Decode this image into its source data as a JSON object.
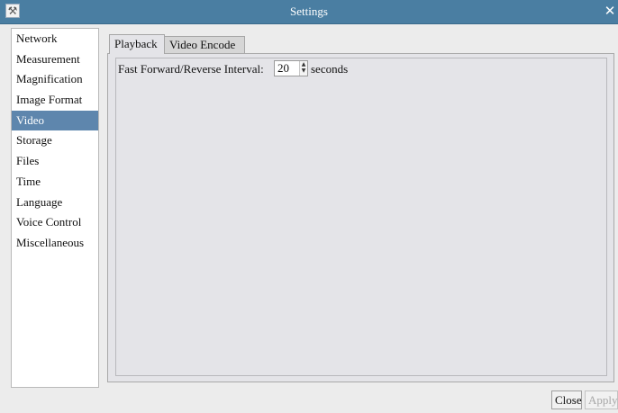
{
  "window": {
    "title": "Settings"
  },
  "sidebar": {
    "items": [
      {
        "label": "Network"
      },
      {
        "label": "Measurement"
      },
      {
        "label": "Magnification"
      },
      {
        "label": "Image Format"
      },
      {
        "label": "Video",
        "selected": true
      },
      {
        "label": "Storage"
      },
      {
        "label": "Files"
      },
      {
        "label": "Time"
      },
      {
        "label": "Language"
      },
      {
        "label": "Voice Control"
      },
      {
        "label": "Miscellaneous"
      }
    ]
  },
  "tabs": [
    {
      "label": "Playback",
      "active": true
    },
    {
      "label": "Video Encode",
      "active": false
    }
  ],
  "playback": {
    "interval_label": "Fast Forward/Reverse Interval:",
    "interval_value": "20",
    "interval_units": "seconds"
  },
  "footer": {
    "close_label": "Close",
    "apply_label": "Apply"
  },
  "colors": {
    "titlebar": "#4a7ea2",
    "selected": "#5e86ad"
  },
  "icons": {
    "app": "settings-tools-icon",
    "close": "close-icon",
    "spin": "spin-arrows-icon"
  }
}
